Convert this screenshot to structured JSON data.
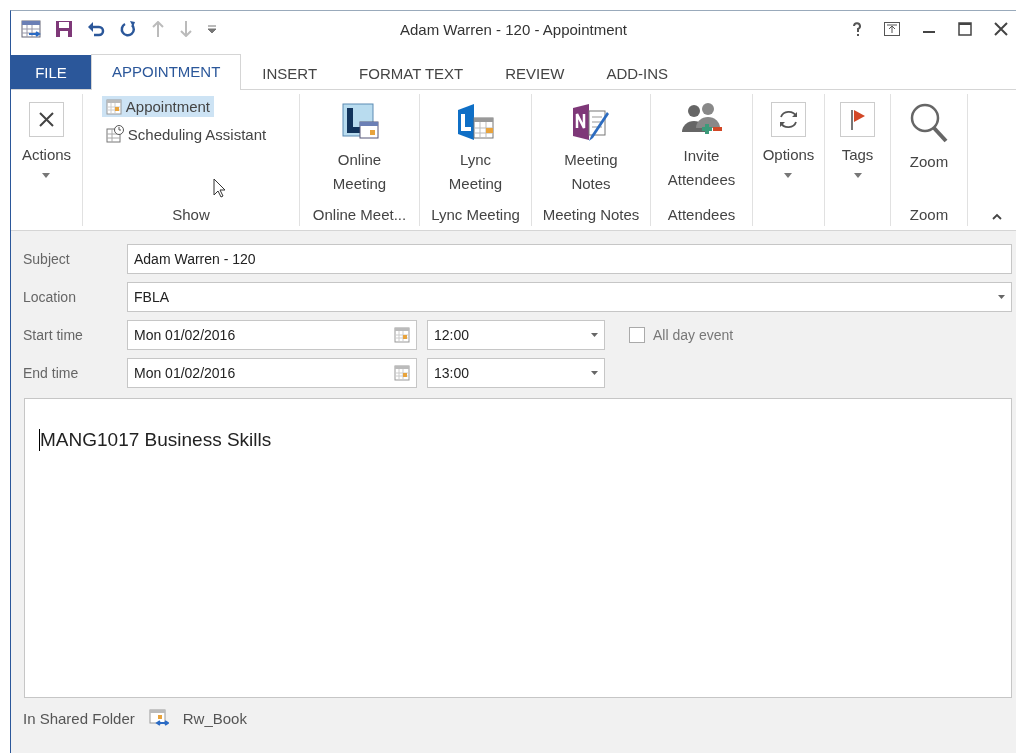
{
  "window": {
    "title": "Adam Warren - 120 - Appointment"
  },
  "tabs": [
    {
      "label": "FILE",
      "kind": "file",
      "selected": false
    },
    {
      "label": "APPOINTMENT",
      "kind": "tab",
      "selected": true
    },
    {
      "label": "INSERT",
      "kind": "tab",
      "selected": false
    },
    {
      "label": "FORMAT TEXT",
      "kind": "tab",
      "selected": false
    },
    {
      "label": "REVIEW",
      "kind": "tab",
      "selected": false
    },
    {
      "label": "ADD-INS",
      "kind": "tab",
      "selected": false
    }
  ],
  "ribbon": {
    "groups": [
      {
        "buttons": [
          {
            "label": "Actions",
            "kind": "large",
            "dropdown": true
          }
        ]
      },
      {
        "label": "Show",
        "buttons": [
          {
            "label": "Appointment",
            "kind": "small",
            "selected": true
          },
          {
            "label": "Scheduling Assistant",
            "kind": "small",
            "selected": false
          }
        ]
      },
      {
        "label": "Online Meet...",
        "buttons": [
          {
            "label": "Online Meeting",
            "kind": "large",
            "dropdown": false
          }
        ]
      },
      {
        "label": "Lync Meeting",
        "buttons": [
          {
            "label": "Lync Meeting",
            "kind": "large",
            "dropdown": false
          }
        ]
      },
      {
        "label": "Meeting Notes",
        "buttons": [
          {
            "label": "Meeting Notes",
            "kind": "large",
            "dropdown": false
          }
        ]
      },
      {
        "label": "Attendees",
        "buttons": [
          {
            "label": "Invite Attendees",
            "kind": "large",
            "dropdown": false
          }
        ]
      },
      {
        "buttons": [
          {
            "label": "Options",
            "kind": "large",
            "dropdown": true
          }
        ]
      },
      {
        "buttons": [
          {
            "label": "Tags",
            "kind": "large",
            "dropdown": true
          }
        ]
      },
      {
        "label": "Zoom",
        "buttons": [
          {
            "label": "Zoom",
            "kind": "large",
            "dropdown": false
          }
        ]
      }
    ]
  },
  "form": {
    "subject": {
      "label": "Subject",
      "value": "Adam Warren - 120"
    },
    "location": {
      "label": "Location",
      "value": "FBLA"
    },
    "start": {
      "label": "Start time",
      "date": "Mon 01/02/2016",
      "time": "12:00"
    },
    "all_day": {
      "label": "All day event",
      "checked": false
    },
    "end": {
      "label": "End time",
      "date": "Mon 01/02/2016",
      "time": "13:00"
    }
  },
  "body": {
    "text": "MANG1017 Business Skills"
  },
  "status_bar": {
    "label": "In Shared Folder",
    "folder": "Rw_Book"
  }
}
